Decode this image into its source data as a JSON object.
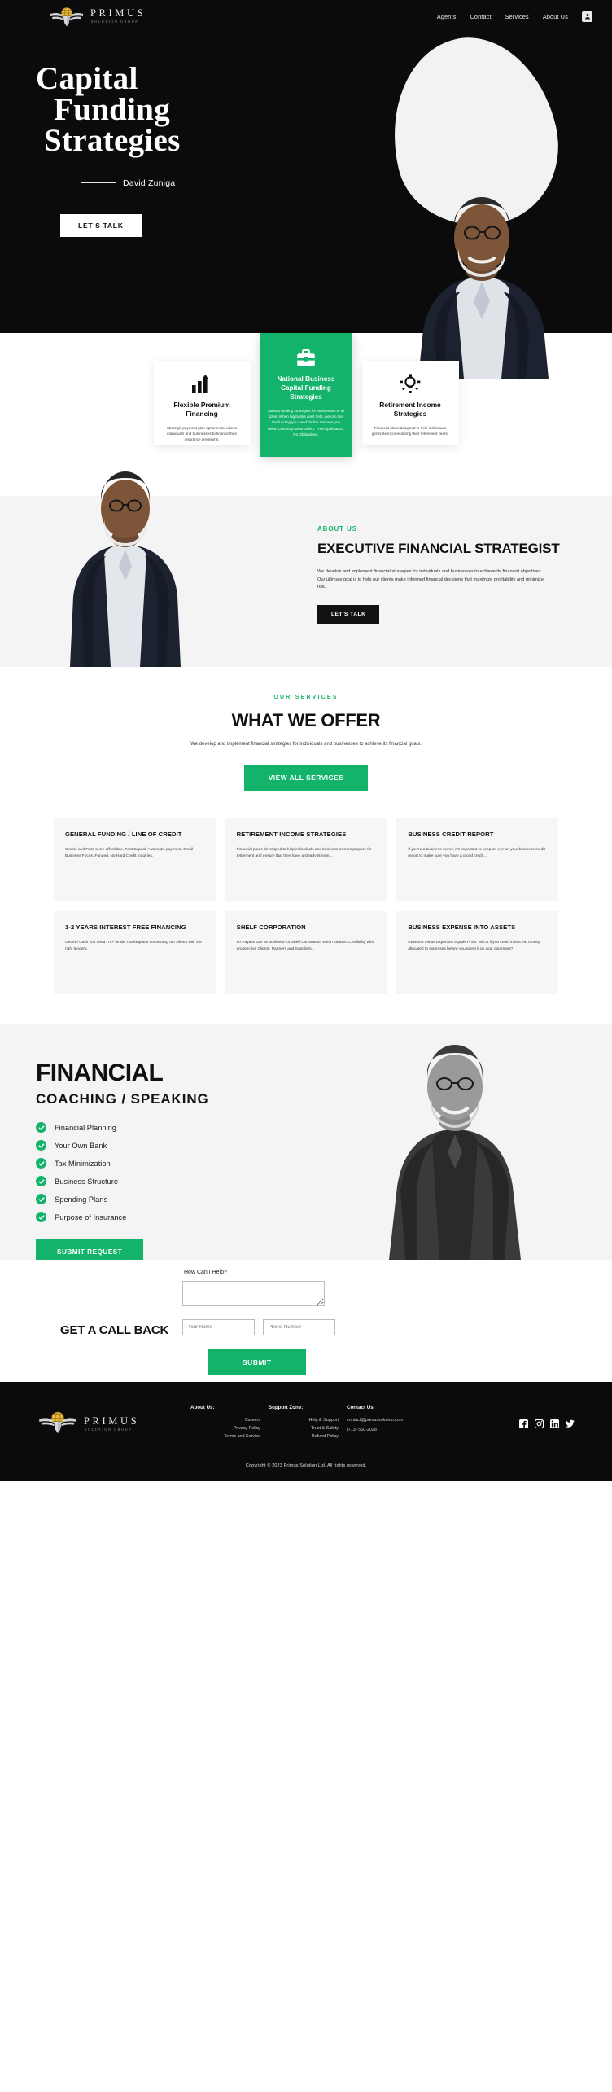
{
  "nav": {
    "brand_name": "PRIMUS",
    "brand_sub": "SOLUTION GROUP",
    "links": [
      "Agents",
      "Contact",
      "Services",
      "About Us"
    ],
    "avatar_icon": "user-avatar-icon"
  },
  "hero": {
    "title_line1": "Capital",
    "title_line2": "Funding",
    "title_line3": "Strategies",
    "byline": "David Zuniga",
    "cta": "LET'S TALK",
    "portrait_alt": "portrait-of-david-zuniga"
  },
  "cards": [
    {
      "icon": "bar-chart-up-icon",
      "title": "Flexible Premium Financing",
      "text": "Strategic payment plan options that allows individuals and businesses to finance their insurance premiums."
    },
    {
      "icon": "briefcase-icon",
      "title": "National Business Capital Funding Strategies",
      "text": "Various funding strategies for businesses of all sizes. When big banks can't help, we can Get the funding you need for the reasons you need. One stop. Best Offers. Free Application, No Obligations."
    },
    {
      "icon": "lightbulb-icon",
      "title": "Retirement Income Strategies",
      "text": "Financial plans designed to help individuals generate income during their retirement years."
    }
  ],
  "about": {
    "eyebrow": "ABOUT US",
    "heading": "EXECUTIVE FINANCIAL STRATEGIST",
    "paragraph": "We develop and implement financial strategies for individuals and businesses to achieve its financial objectives. Our ultimate goal is to help our clients make informed financial decisions that maximize profitability and minimize risk.",
    "cta": "LET'S TALK"
  },
  "services": {
    "eyebrow": "OUR SERVICES",
    "heading": "WHAT WE OFFER",
    "subtext": "We develop and implement financial strategies for individuals and businesses to achieve its financial goals.",
    "cta": "VIEW ALL SERVICES",
    "items": [
      {
        "title": "GENERAL FUNDING / LINE OF CREDIT",
        "text": "Simple and Fast, More affordable, Fast Capital, Automatic payment,  Small Business Focus, Funded, No Hard Credit Inquiries."
      },
      {
        "title": "RETIREMENT INCOME STRATEGIES",
        "text": "Financial plans developed to help individuals and business owners prepare for retirement and ensure that they have a steady stream..."
      },
      {
        "title": "BUSINESS CREDIT REPORT",
        "text": "If you're a business owner, it's important to keep an eye on your business credit report to make sure you have a g ood credit..."
      },
      {
        "title": "1-2 YEARS INTEREST FREE FINANCING",
        "text": "Get the Cash you need. 75+ lender marketplace connecting our clients with the right lenders."
      },
      {
        "title": "SHELF CORPORATION",
        "text": "80 Paydex can be achieved for Shelf Corporation within 45days. Credibility with prospective Clients, Partners and Suppliers."
      },
      {
        "title": "BUSINESS EXPENSE INTO ASSETS",
        "text": "Revenue minus Expenses equals Profit. Wh at if you could invest the money allocated to expenses before you spent it on your expenses?"
      }
    ]
  },
  "coaching": {
    "heading_top": "FINANCIAL",
    "heading_bottom": "COACHING / SPEAKING",
    "bullets": [
      "Financial Planning",
      "Your Own Bank",
      "Tax Minimization",
      "Business Structure",
      "Spending Plans",
      "Purpose of Insurance"
    ],
    "cta": "SUBMIT REQUEST",
    "photo_alt": "coaching-portrait"
  },
  "callback": {
    "question_label": "How Can I Help?",
    "message_value": "",
    "heading": "GET A CALL BACK",
    "name_placeholder": "Your Name",
    "phone_placeholder": "Phone Number",
    "name_value": "",
    "phone_value": "",
    "submit": "SUBMIT"
  },
  "footer": {
    "brand_name": "PRIMUS",
    "brand_sub": "SOLUTION GROUP",
    "columns": [
      {
        "heading": "About Us:",
        "items": [
          "Careers",
          "Privacy Policy",
          "Terms and Service"
        ]
      },
      {
        "heading": "Support Zone:",
        "items": [
          "Help & Support",
          "Trust & Safety",
          "Refund Policy"
        ]
      },
      {
        "heading": "Contact Us:",
        "items": [
          "contact@primussolution.com",
          "(713) 560-2028"
        ]
      }
    ],
    "social": [
      "facebook-icon",
      "instagram-icon",
      "linkedin-icon",
      "twitter-icon"
    ],
    "copyright": "Copyright © 2023 Primus Solution Ltd. All rights reserved."
  },
  "colors": {
    "green": "#13b36b",
    "dark": "#0b0b0b",
    "gold": "#e8b63c"
  }
}
